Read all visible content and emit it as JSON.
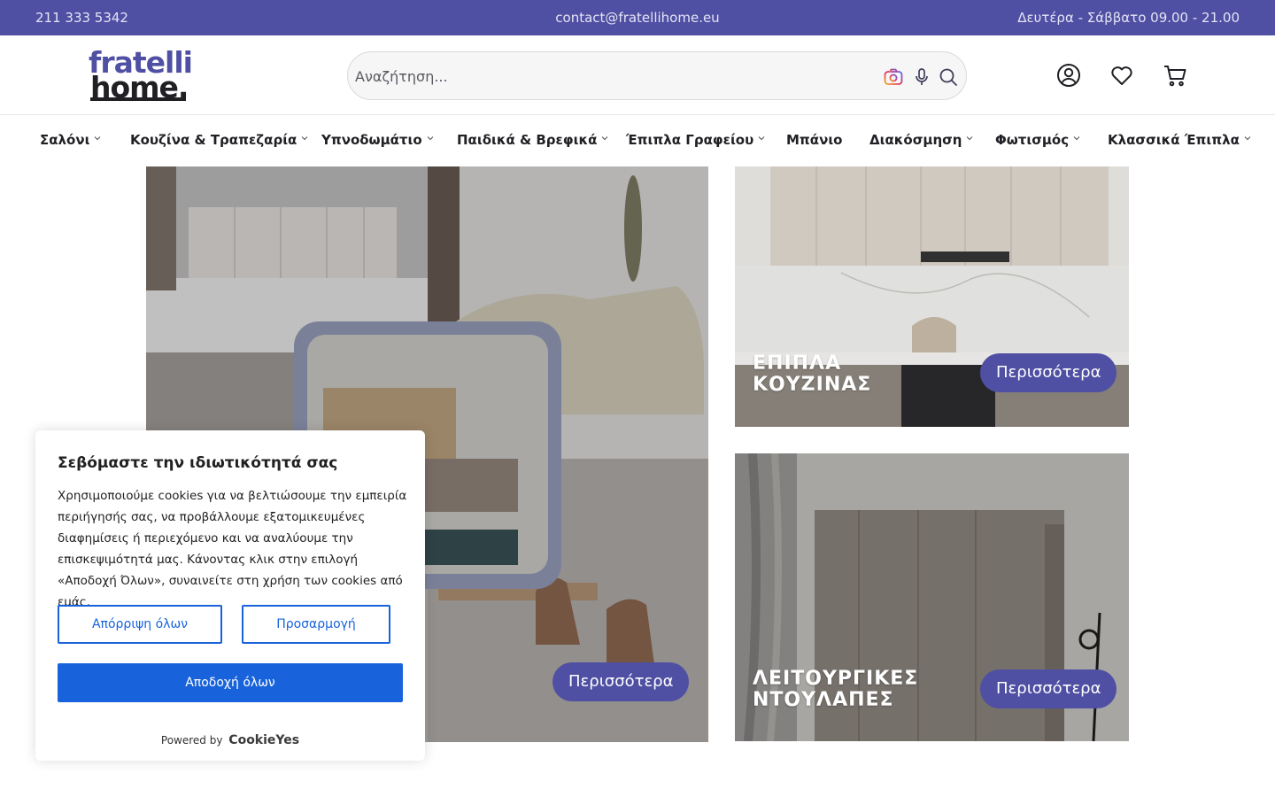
{
  "topbar": {
    "phone": "211 333 5342",
    "email": "contact@fratellihome.eu",
    "hours": "Δευτέρα - Σάββατο 09.00 - 21.00"
  },
  "brand": {
    "logo_line1": "fratelli",
    "logo_line2": "home."
  },
  "search": {
    "placeholder": "Αναζήτηση...",
    "icons": [
      "camera-icon",
      "microphone-icon",
      "search-icon"
    ]
  },
  "header_icons": [
    "account-icon",
    "heart-icon",
    "cart-icon"
  ],
  "nav": {
    "items": [
      {
        "label": "Σαλόνι",
        "has_dropdown": true
      },
      {
        "label": "Κουζίνα & Τραπεζαρία",
        "has_dropdown": true
      },
      {
        "label": "Υπνοδωμάτιο",
        "has_dropdown": true
      },
      {
        "label": "Παιδικά & Βρεφικά",
        "has_dropdown": true
      },
      {
        "label": "Έπιπλα Γραφείου",
        "has_dropdown": true
      },
      {
        "label": "Μπάνιο",
        "has_dropdown": false
      },
      {
        "label": "Διακόσμηση",
        "has_dropdown": true
      },
      {
        "label": "Φωτισμός",
        "has_dropdown": true
      },
      {
        "label": "Κλασσικά Έπιπλα",
        "has_dropdown": true
      }
    ]
  },
  "tiles": {
    "left": {
      "button": "Περισσότερα"
    },
    "kitchen": {
      "title_line1": "ΕΠΙΠΛΑ",
      "title_line2": "ΚΟΥΖΙΝΑΣ",
      "button": "Περισσότερα"
    },
    "wardrobe": {
      "title_line1": "ΛΕΙΤΟΥΡΓΙΚΕΣ",
      "title_line2": "ΝΤΟΥΛΑΠΕΣ",
      "button": "Περισσότερα"
    }
  },
  "cookie": {
    "title": "Σεβόμαστε την ιδιωτικότητά σας",
    "body": "Χρησιμοποιούμε cookies για να βελτιώσουμε την εμπειρία περιήγησής σας, να προβάλλουμε εξατομικευμένες διαφημίσεις ή περιεχόμενο και να αναλύουμε την επισκεψιμότητά μας. Κάνοντας κλικ στην επιλογή «Αποδοχή Όλων», συναινείτε στη χρήση των cookies από εμάς.",
    "reject_label": "Απόρριψη όλων",
    "customize_label": "Προσαρμογή",
    "accept_label": "Αποδοχή όλων",
    "powered_by": "Powered by",
    "powered_brand": "CookieYes"
  },
  "colors": {
    "brand_purple": "#4f4fa3",
    "cookie_blue": "#1863dc"
  }
}
